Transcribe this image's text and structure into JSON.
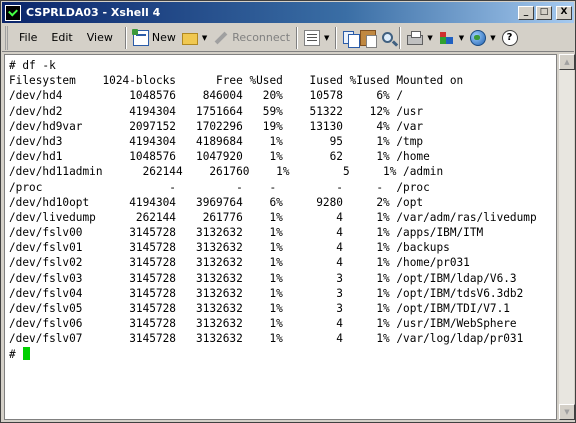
{
  "window": {
    "title": "CSPRLDA03 - Xshell 4",
    "buttons": {
      "minimize": "_",
      "maximize": "□",
      "close": "X"
    }
  },
  "menu": {
    "items": [
      {
        "label": "File"
      },
      {
        "label": "Edit"
      },
      {
        "label": "View"
      }
    ]
  },
  "toolbar": {
    "new_label": "New",
    "reconnect_label": "Reconnect",
    "help_glyph": "?"
  },
  "terminal": {
    "lines": [
      "# df -k",
      "Filesystem    1024-blocks      Free %Used    Iused %Iused Mounted on",
      "/dev/hd4          1048576    846004   20%    10578     6% /",
      "/dev/hd2          4194304   1751664   59%    51322    12% /usr",
      "/dev/hd9var       2097152   1702296   19%    13130     4% /var",
      "/dev/hd3          4194304   4189684    1%       95     1% /tmp",
      "/dev/hd1          1048576   1047920    1%       62     1% /home",
      "/dev/hd11admin      262144    261760    1%        5     1% /admin",
      "/proc                   -         -    -         -     -  /proc",
      "/dev/hd10opt      4194304   3969764    6%     9280     2% /opt",
      "/dev/livedump      262144    261776    1%        4     1% /var/adm/ras/livedump",
      "/dev/fslv00       3145728   3132632    1%        4     1% /apps/IBM/ITM",
      "/dev/fslv01       3145728   3132632    1%        4     1% /backups",
      "/dev/fslv02       3145728   3132632    1%        4     1% /home/pr031",
      "/dev/fslv03       3145728   3132632    1%        3     1% /opt/IBM/ldap/V6.3",
      "/dev/fslv04       3145728   3132632    1%        3     1% /opt/IBM/tdsV6.3db2",
      "/dev/fslv05       3145728   3132632    1%        3     1% /opt/IBM/TDI/V7.1",
      "/dev/fslv06       3145728   3132632    1%        4     1% /usr/IBM/WebSphere",
      "/dev/fslv07       3145728   3132632    1%        4     1% /var/log/ldap/pr031"
    ],
    "prompt": "# ",
    "cursor_color": "#00d000"
  },
  "colors": {
    "titlebar_start": "#0a246a",
    "titlebar_end": "#a6caf0",
    "chrome": "#d4d0c8",
    "terminal_bg": "#ffffff"
  },
  "icons": [
    "app-icon",
    "new-session-icon",
    "open-folder-icon",
    "reconnect-icon",
    "properties-icon",
    "copy-icon",
    "paste-icon",
    "find-icon",
    "print-icon",
    "color-scheme-icon",
    "globe-icon",
    "help-icon"
  ]
}
